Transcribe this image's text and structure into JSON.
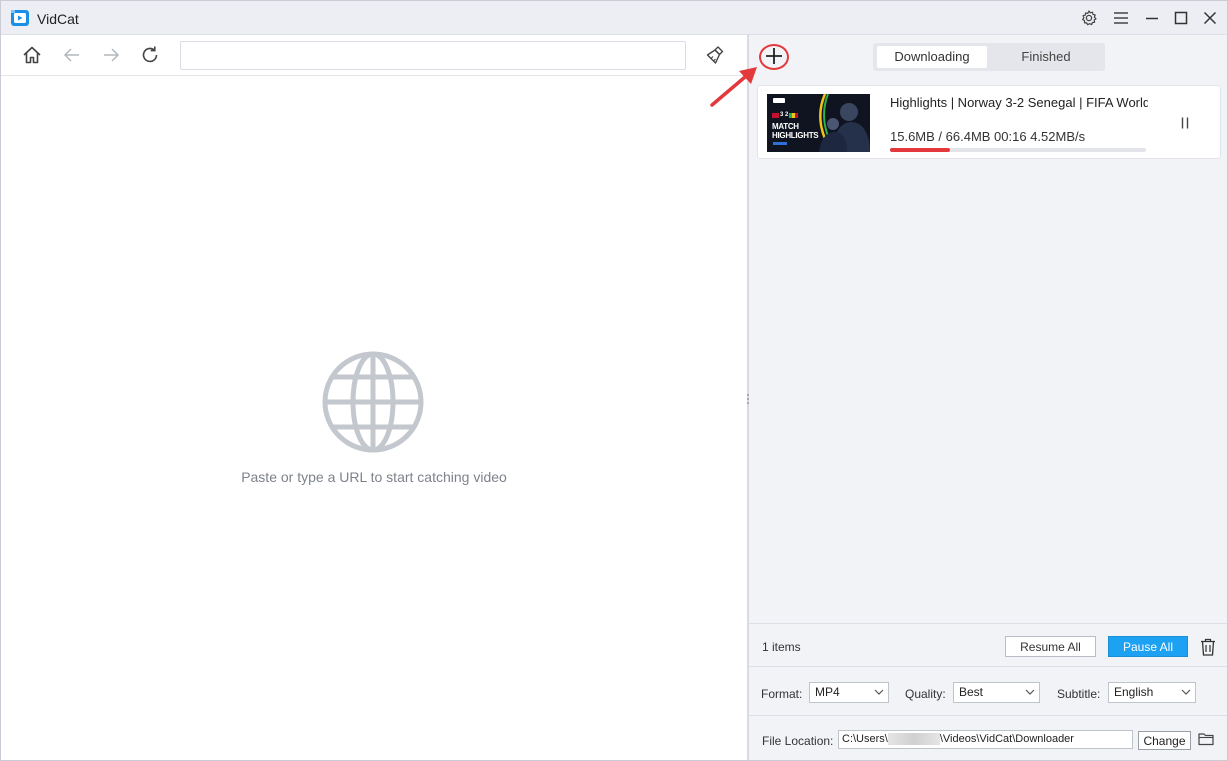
{
  "app": {
    "title": "VidCat"
  },
  "browser": {
    "url_value": "",
    "empty_message": "Paste or type a URL to start catching video"
  },
  "tabs": [
    {
      "label": "Downloading",
      "active": true
    },
    {
      "label": "Finished",
      "active": false
    }
  ],
  "downloads": [
    {
      "title": "Highlights | Norway 3-2 Senegal | FIFA World",
      "stats": "15.6MB / 66.4MB 00:16  4.52MB/s",
      "progress": 0.235,
      "thumbnail": {
        "score": "3 2",
        "line1": "MATCH",
        "line2": "HIGHLIGHTS"
      }
    }
  ],
  "footer": {
    "items_count": "1 items",
    "resume_all": "Resume All",
    "pause_all": "Pause All",
    "format_label": "Format:",
    "format_value": "MP4",
    "quality_label": "Quality:",
    "quality_value": "Best",
    "subtitle_label": "Subtitle:",
    "subtitle_value": "English",
    "location_label": "File Location:",
    "location_prefix": "C:\\Users\\",
    "location_suffix": "\\Videos\\VidCat\\Downloader",
    "change_label": "Change"
  },
  "colors": {
    "accent_blue": "#1da1f2",
    "progress_red": "#e4393c",
    "highlight_red": "#e4393c"
  }
}
